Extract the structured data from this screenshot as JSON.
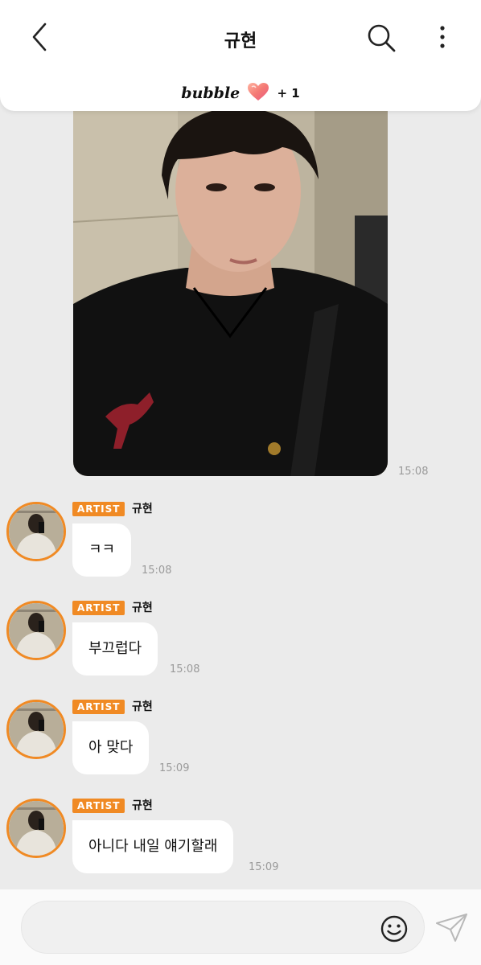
{
  "header": {
    "title": "규현",
    "bubble_logo": "bubble",
    "bubble_count": "+ 1"
  },
  "photo_message": {
    "time": "15:08"
  },
  "messages": [
    {
      "badge": "ARTIST",
      "sender": "규현",
      "text": "ㅋㅋ",
      "time": "15:08"
    },
    {
      "badge": "ARTIST",
      "sender": "규현",
      "text": "부끄럽다",
      "time": "15:08"
    },
    {
      "badge": "ARTIST",
      "sender": "규현",
      "text": "아 맞다",
      "time": "15:09"
    },
    {
      "badge": "ARTIST",
      "sender": "규현",
      "text": "아니다 내일 얘기할래",
      "time": "15:09"
    }
  ],
  "input": {
    "placeholder": ""
  },
  "colors": {
    "accent": "#f08a24",
    "background": "#ebebeb"
  }
}
